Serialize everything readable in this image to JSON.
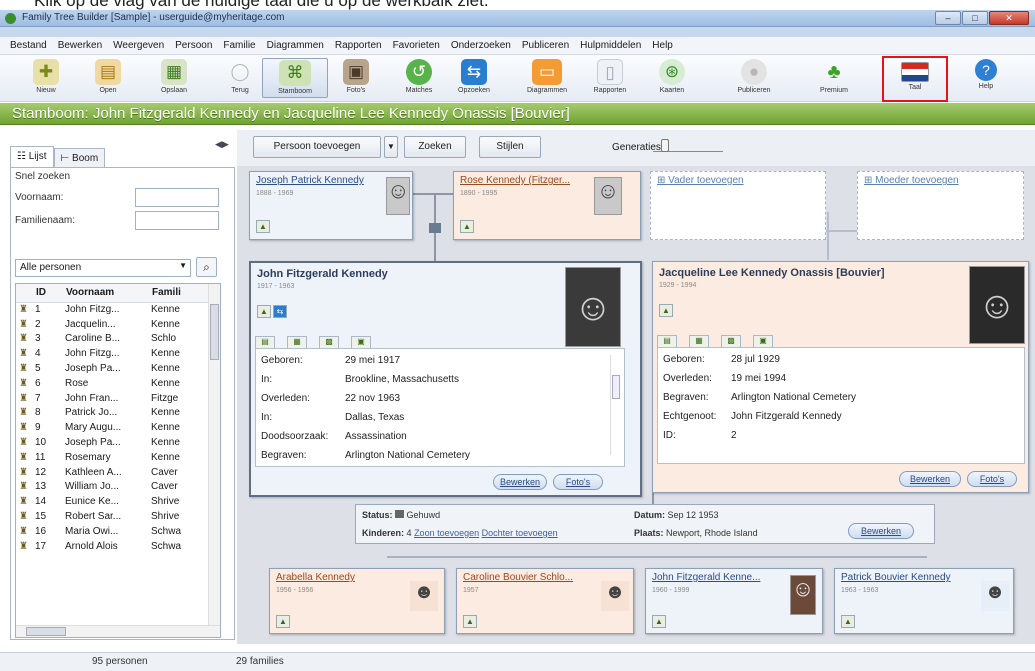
{
  "instruction_text": "Klik op de vlag van de huidige taal die u op de werkbalk ziet.",
  "window": {
    "title": "Family Tree Builder [Sample] - userguide@myheritage.com"
  },
  "menu": [
    "Bestand",
    "Bewerken",
    "Weergeven",
    "Persoon",
    "Familie",
    "Diagrammen",
    "Rapporten",
    "Favorieten",
    "Onderzoeken",
    "Publiceren",
    "Hulpmiddelen",
    "Help"
  ],
  "toolbar": [
    {
      "label": "Nieuw",
      "icon": "new-icon"
    },
    {
      "label": "Open",
      "icon": "open-icon"
    },
    {
      "label": "Opslaan",
      "icon": "save-icon"
    },
    {
      "label": "Terug",
      "icon": "back-icon"
    },
    {
      "label": "Stamboom",
      "icon": "family-tree-icon"
    },
    {
      "label": "Foto's",
      "icon": "photos-icon"
    },
    {
      "label": "Matches",
      "icon": "matches-icon"
    },
    {
      "label": "Opzoeken",
      "icon": "lookup-icon"
    },
    {
      "label": "Diagrammen",
      "icon": "charts-icon"
    },
    {
      "label": "Rapporten",
      "icon": "reports-icon"
    },
    {
      "label": "Kaarten",
      "icon": "maps-icon"
    },
    {
      "label": "Publiceren",
      "icon": "publish-icon"
    },
    {
      "label": "Premium",
      "icon": "premium-icon"
    },
    {
      "label": "Taal",
      "icon": "language-flag-icon"
    },
    {
      "label": "Help",
      "icon": "help-icon"
    }
  ],
  "banner": "Stamboom: John Fitzgerald Kennedy en Jacqueline Lee Kennedy Onassis [Bouvier]",
  "sidebar": {
    "tab_list": "Lijst",
    "tab_tree": "Boom",
    "quick_search": "Snel zoeken",
    "first_name_label": "Voornaam:",
    "last_name_label": "Familienaam:",
    "filter_value": "Alle personen",
    "columns": [
      "ID",
      "Voornaam",
      "Famili"
    ],
    "rows": [
      [
        "1",
        "John Fitzg...",
        "Kenne"
      ],
      [
        "2",
        "Jacquelin...",
        "Kenne"
      ],
      [
        "3",
        "Caroline B...",
        "Schlo"
      ],
      [
        "4",
        "John Fitzg...",
        "Kenne"
      ],
      [
        "5",
        "Joseph Pa...",
        "Kenne"
      ],
      [
        "6",
        "Rose",
        "Kenne"
      ],
      [
        "7",
        "John Fran...",
        "Fitzge"
      ],
      [
        "8",
        "Patrick Jo...",
        "Kenne"
      ],
      [
        "9",
        "Mary Augu...",
        "Kenne"
      ],
      [
        "10",
        "Joseph Pa...",
        "Kenne"
      ],
      [
        "11",
        "Rosemary",
        "Kenne"
      ],
      [
        "12",
        "Kathleen A...",
        "Caver"
      ],
      [
        "13",
        "William Jo...",
        "Caver"
      ],
      [
        "14",
        "Eunice Ke...",
        "Shrive"
      ],
      [
        "15",
        "Robert Sar...",
        "Shrive"
      ],
      [
        "16",
        "Maria Owi...",
        "Schwa"
      ],
      [
        "17",
        "Arnold Alois",
        "Schwa"
      ]
    ]
  },
  "actions": {
    "add_person": "Persoon toevoegen",
    "search": "Zoeken",
    "styles": "Stijlen",
    "generations": "Generaties:"
  },
  "parents": {
    "father_father": {
      "name": "Joseph Patrick Kennedy",
      "dates": "1888 - 1969"
    },
    "father_mother": {
      "name": "Rose Kennedy (Fitzger...",
      "dates": "1890 - 1995"
    },
    "add_father": "Vader toevoegen",
    "add_mother": "Moeder toevoegen"
  },
  "husband": {
    "name": "John Fitzgerald Kennedy",
    "dates": "1917 - 1963",
    "details": [
      [
        "Geboren:",
        "29 mei 1917"
      ],
      [
        "In:",
        "Brookline, Massachusetts"
      ],
      [
        "Overleden:",
        "22 nov 1963"
      ],
      [
        "In:",
        "Dallas, Texas"
      ],
      [
        "Doodsoorzaak:",
        "Assassination"
      ],
      [
        "Begraven:",
        "Arlington National Cemetery"
      ]
    ],
    "edit": "Bewerken",
    "photos": "Foto's"
  },
  "wife": {
    "name": "Jacqueline Lee Kennedy Onassis [Bouvier]",
    "dates": "1929 - 1994",
    "details": [
      [
        "Geboren:",
        "28 jul 1929"
      ],
      [
        "Overleden:",
        "19 mei 1994"
      ],
      [
        "Begraven:",
        "Arlington National Cemetery"
      ],
      [
        "Echtgenoot:",
        "John Fitzgerald Kennedy"
      ],
      [
        "ID:",
        "2"
      ]
    ],
    "edit": "Bewerken",
    "photos": "Foto's"
  },
  "family": {
    "status_label": "Status:",
    "status_value": "Gehuwd",
    "children_label": "Kinderen:",
    "children_count": "4",
    "add_son": "Zoon toevoegen",
    "add_daughter": "Dochter toevoegen",
    "date_label": "Datum:",
    "date_value": "Sep 12 1953",
    "place_label": "Plaats:",
    "place_value": "Newport, Rhode Island",
    "edit": "Bewerken"
  },
  "children": [
    {
      "name": "Arabella Kennedy",
      "dates": "1956 - 1956",
      "sex": "f"
    },
    {
      "name": "Caroline Bouvier Schlo...",
      "dates": "1957",
      "sex": "f"
    },
    {
      "name": "John Fitzgerald Kenne...",
      "dates": "1960 - 1999",
      "sex": "m"
    },
    {
      "name": "Patrick Bouvier Kennedy",
      "dates": "1963 - 1963",
      "sex": "m"
    }
  ],
  "status": {
    "persons": "95 personen",
    "families": "29 families"
  },
  "colors": {
    "banner": "#6ea331",
    "highlight": "#e5141c",
    "male_card": "#eef3f9",
    "female_card": "#fcebe0"
  }
}
